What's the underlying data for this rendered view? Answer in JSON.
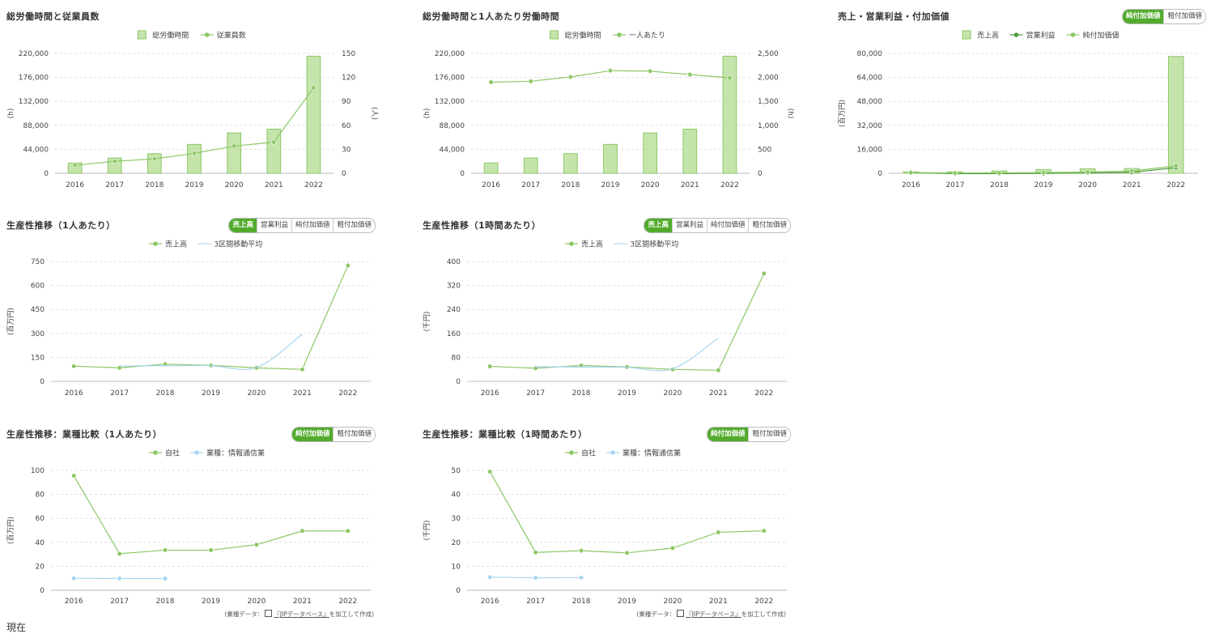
{
  "colors": {
    "green": "#8cc866",
    "green_bar": "#c5e4ab",
    "green_dark": "#4f9a3f",
    "blue": "#a8d5f0",
    "toggle_active": "#52ab2c",
    "grid": "#dddddd"
  },
  "source_note": {
    "prefix": "(業種データ：",
    "link": "『JIPデータベース』",
    "suffix": "を加工して作成)"
  },
  "cutoff_text": "現在",
  "panels": [
    {
      "id": "p1",
      "title": "総労働時間と従業員数",
      "toggle": [],
      "chart_data": {
        "type": "bar+line",
        "categories": [
          "2016",
          "2017",
          "2018",
          "2019",
          "2020",
          "2021",
          "2022"
        ],
        "series": [
          {
            "name": "総労働時間",
            "type": "bar",
            "axis": "left",
            "values": [
              19000,
              28000,
              36000,
              53000,
              74000,
              81000,
              215000
            ]
          },
          {
            "name": "従業員数",
            "type": "line",
            "axis": "right",
            "values": [
              10,
              15,
              18,
              25,
              34,
              39,
              107
            ]
          }
        ],
        "ylabel_left": "(h)",
        "ylabel_right": "(人)",
        "yleft_ticks": [
          "220,000",
          "176,000",
          "132,000",
          "88,000",
          "44,000",
          "0"
        ],
        "ylim_left": [
          0,
          220000
        ],
        "yright_ticks": [
          "150",
          "120",
          "90",
          "60",
          "30",
          "0"
        ],
        "ylim_right": [
          0,
          150
        ]
      }
    },
    {
      "id": "p2",
      "title": "総労働時間と1人あたり労働時間",
      "toggle": [],
      "chart_data": {
        "type": "bar+line",
        "categories": [
          "2016",
          "2017",
          "2018",
          "2019",
          "2020",
          "2021",
          "2022"
        ],
        "series": [
          {
            "name": "総労働時間",
            "type": "bar",
            "axis": "left",
            "values": [
              19000,
              28000,
              36000,
              53000,
              74000,
              81000,
              215000
            ]
          },
          {
            "name": "一人あたり",
            "type": "line",
            "axis": "right",
            "values": [
              1900,
              1920,
              2010,
              2140,
              2130,
              2060,
              1990
            ]
          }
        ],
        "ylabel_left": "(h)",
        "ylabel_right": "(h)",
        "yleft_ticks": [
          "220,000",
          "176,000",
          "132,000",
          "88,000",
          "44,000",
          "0"
        ],
        "ylim_left": [
          0,
          220000
        ],
        "yright_ticks": [
          "2,500",
          "2,000",
          "1,500",
          "1,000",
          "500",
          "0"
        ],
        "ylim_right": [
          0,
          2500
        ]
      }
    },
    {
      "id": "p3",
      "title": "売上・営業利益・付加価値",
      "toggle": [
        "純付加価値",
        "粗付加価値"
      ],
      "toggle_active": 0,
      "chart_data": {
        "type": "bar+line",
        "categories": [
          "2016",
          "2017",
          "2018",
          "2019",
          "2020",
          "2021",
          "2022"
        ],
        "series": [
          {
            "name": "売上高",
            "type": "bar",
            "axis": "left",
            "values": [
              900,
              1000,
              1600,
              2500,
              3000,
              3200,
              78000
            ]
          },
          {
            "name": "営業利益",
            "type": "line",
            "axis": "left",
            "dark": true,
            "values": [
              400,
              -300,
              -200,
              -100,
              200,
              600,
              3800
            ]
          },
          {
            "name": "純付加価値",
            "type": "line",
            "axis": "left",
            "values": [
              500,
              200,
              300,
              500,
              800,
              1500,
              5000
            ]
          }
        ],
        "ylabel_left": "(百万円)",
        "yleft_ticks": [
          "80,000",
          "64,000",
          "48,000",
          "32,000",
          "16,000",
          "0"
        ],
        "ylim_left": [
          0,
          80000
        ]
      }
    },
    {
      "id": "p4",
      "title": "生産性推移（1人あたり）",
      "toggle": [
        "売上高",
        "営業利益",
        "純付加価値",
        "粗付加価値"
      ],
      "toggle_active": 0,
      "chart_data": {
        "type": "line",
        "categories": [
          "2016",
          "2017",
          "2018",
          "2019",
          "2020",
          "2021",
          "2022"
        ],
        "series": [
          {
            "name": "売上高",
            "values": [
              95,
              85,
              108,
              100,
              85,
              75,
              725
            ],
            "markers": true
          },
          {
            "name": "3区間移動平均",
            "values": [
              null,
              96,
              98,
              98,
              87,
              295,
              null
            ],
            "smooth": true,
            "color": "blue"
          }
        ],
        "ylabel_left": "(百万円)",
        "yleft_ticks": [
          "750",
          "600",
          "450",
          "300",
          "150",
          "0"
        ],
        "ylim_left": [
          0,
          750
        ]
      }
    },
    {
      "id": "p5",
      "title": "生産性推移（1時間あたり）",
      "toggle": [
        "売上高",
        "営業利益",
        "純付加価値",
        "粗付加価値"
      ],
      "toggle_active": 0,
      "chart_data": {
        "type": "line",
        "categories": [
          "2016",
          "2017",
          "2018",
          "2019",
          "2020",
          "2021",
          "2022"
        ],
        "series": [
          {
            "name": "売上高",
            "values": [
              50,
              44,
              53,
              48,
              40,
              37,
              360
            ],
            "markers": true
          },
          {
            "name": "3区間移動平均",
            "values": [
              null,
              49,
              48,
              47,
              42,
              145,
              null
            ],
            "smooth": true,
            "color": "blue"
          }
        ],
        "ylabel_left": "(千円)",
        "yleft_ticks": [
          "400",
          "320",
          "240",
          "160",
          "80",
          "0"
        ],
        "ylim_left": [
          0,
          400
        ]
      }
    },
    {
      "id": "p6",
      "title": "生産性推移：業種比較（1人あたり）",
      "toggle": [
        "純付加価値",
        "粗付加価値"
      ],
      "toggle_active": 0,
      "source": true,
      "chart_data": {
        "type": "line",
        "categories": [
          "2016",
          "2017",
          "2018",
          "2019",
          "2020",
          "2021",
          "2022"
        ],
        "series": [
          {
            "name": "自社",
            "values": [
              95.5,
              30.5,
              33.5,
              33.5,
              38,
              49.5,
              49.5
            ],
            "markers": true
          },
          {
            "name": "業種：情報通信業",
            "values": [
              10,
              9.8,
              9.8,
              null,
              null,
              null,
              null
            ],
            "markers": true,
            "color": "blue"
          }
        ],
        "ylabel_left": "(百万円)",
        "yleft_ticks": [
          "100",
          "80",
          "60",
          "40",
          "20",
          "0"
        ],
        "ylim_left": [
          0,
          100
        ]
      }
    },
    {
      "id": "p7",
      "title": "生産性推移：業種比較（1時間あたり）",
      "toggle": [
        "純付加価値",
        "粗付加価値"
      ],
      "toggle_active": 0,
      "source": true,
      "chart_data": {
        "type": "line",
        "categories": [
          "2016",
          "2017",
          "2018",
          "2019",
          "2020",
          "2021",
          "2022"
        ],
        "series": [
          {
            "name": "自社",
            "values": [
              49.5,
              15.8,
              16.5,
              15.6,
              17.6,
              24.2,
              24.8
            ],
            "markers": true
          },
          {
            "name": "業種：情報通信業",
            "values": [
              5.5,
              5.2,
              5.3,
              null,
              null,
              null,
              null
            ],
            "markers": true,
            "color": "blue"
          }
        ],
        "ylabel_left": "(千円)",
        "yleft_ticks": [
          "50",
          "40",
          "30",
          "20",
          "10",
          "0"
        ],
        "ylim_left": [
          0,
          50
        ]
      }
    }
  ]
}
